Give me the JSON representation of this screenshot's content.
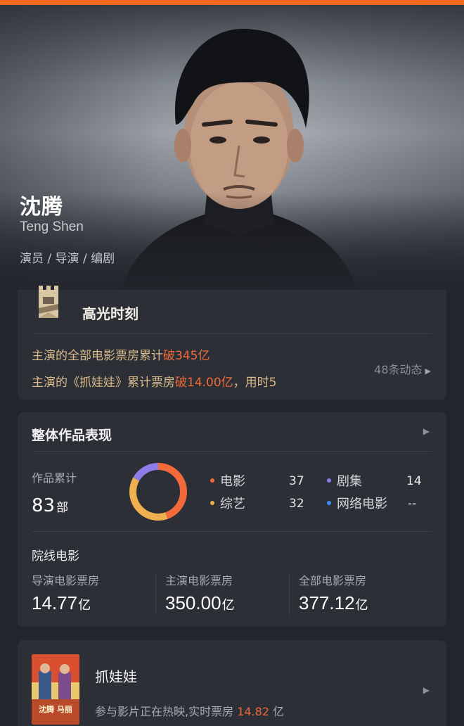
{
  "accent_color": "#f26b1d",
  "hero": {
    "name_cn": "沈腾",
    "name_en": "Teng Shen",
    "roles": "演员 / 导演 / 编剧"
  },
  "highlight": {
    "icon": "castle-icon",
    "title": "高光时刻",
    "line1_prefix": "主演的全部电影票房累计",
    "line1_hot": "破345亿",
    "line2_prefix": "主演的《抓娃娃》累计票房",
    "line2_hot": "破14.00亿",
    "line2_suffix": "，用时5",
    "more": "48条动态"
  },
  "works": {
    "title": "整体作品表现",
    "count_label": "作品累计",
    "count": "83",
    "count_unit": "部",
    "legend": [
      {
        "label": "电影",
        "value": "37",
        "color": "#f26a3a"
      },
      {
        "label": "剧集",
        "value": "14",
        "color": "#8f7ce8"
      },
      {
        "label": "综艺",
        "value": "32",
        "color": "#efb04f"
      },
      {
        "label": "网络电影",
        "value": "--",
        "color": "#3d8df0"
      }
    ],
    "donut": [
      {
        "label": "电影",
        "value": 37,
        "color": "#f26a3a"
      },
      {
        "label": "综艺",
        "value": 32,
        "color": "#efb04f"
      },
      {
        "label": "剧集",
        "value": 14,
        "color": "#8f7ce8"
      }
    ],
    "subsection": "院线电影",
    "stats": [
      {
        "label": "导演电影票房",
        "value": "14.77",
        "unit": "亿"
      },
      {
        "label": "主演电影票房",
        "value": "350.00",
        "unit": "亿"
      },
      {
        "label": "全部电影票房",
        "value": "377.12",
        "unit": "亿"
      }
    ]
  },
  "movie": {
    "title": "抓娃娃",
    "desc_prefix": "参与影片正在热映,实时票房",
    "desc_value": "14.82",
    "desc_unit": "亿",
    "poster_text": "沈腾 马丽"
  }
}
